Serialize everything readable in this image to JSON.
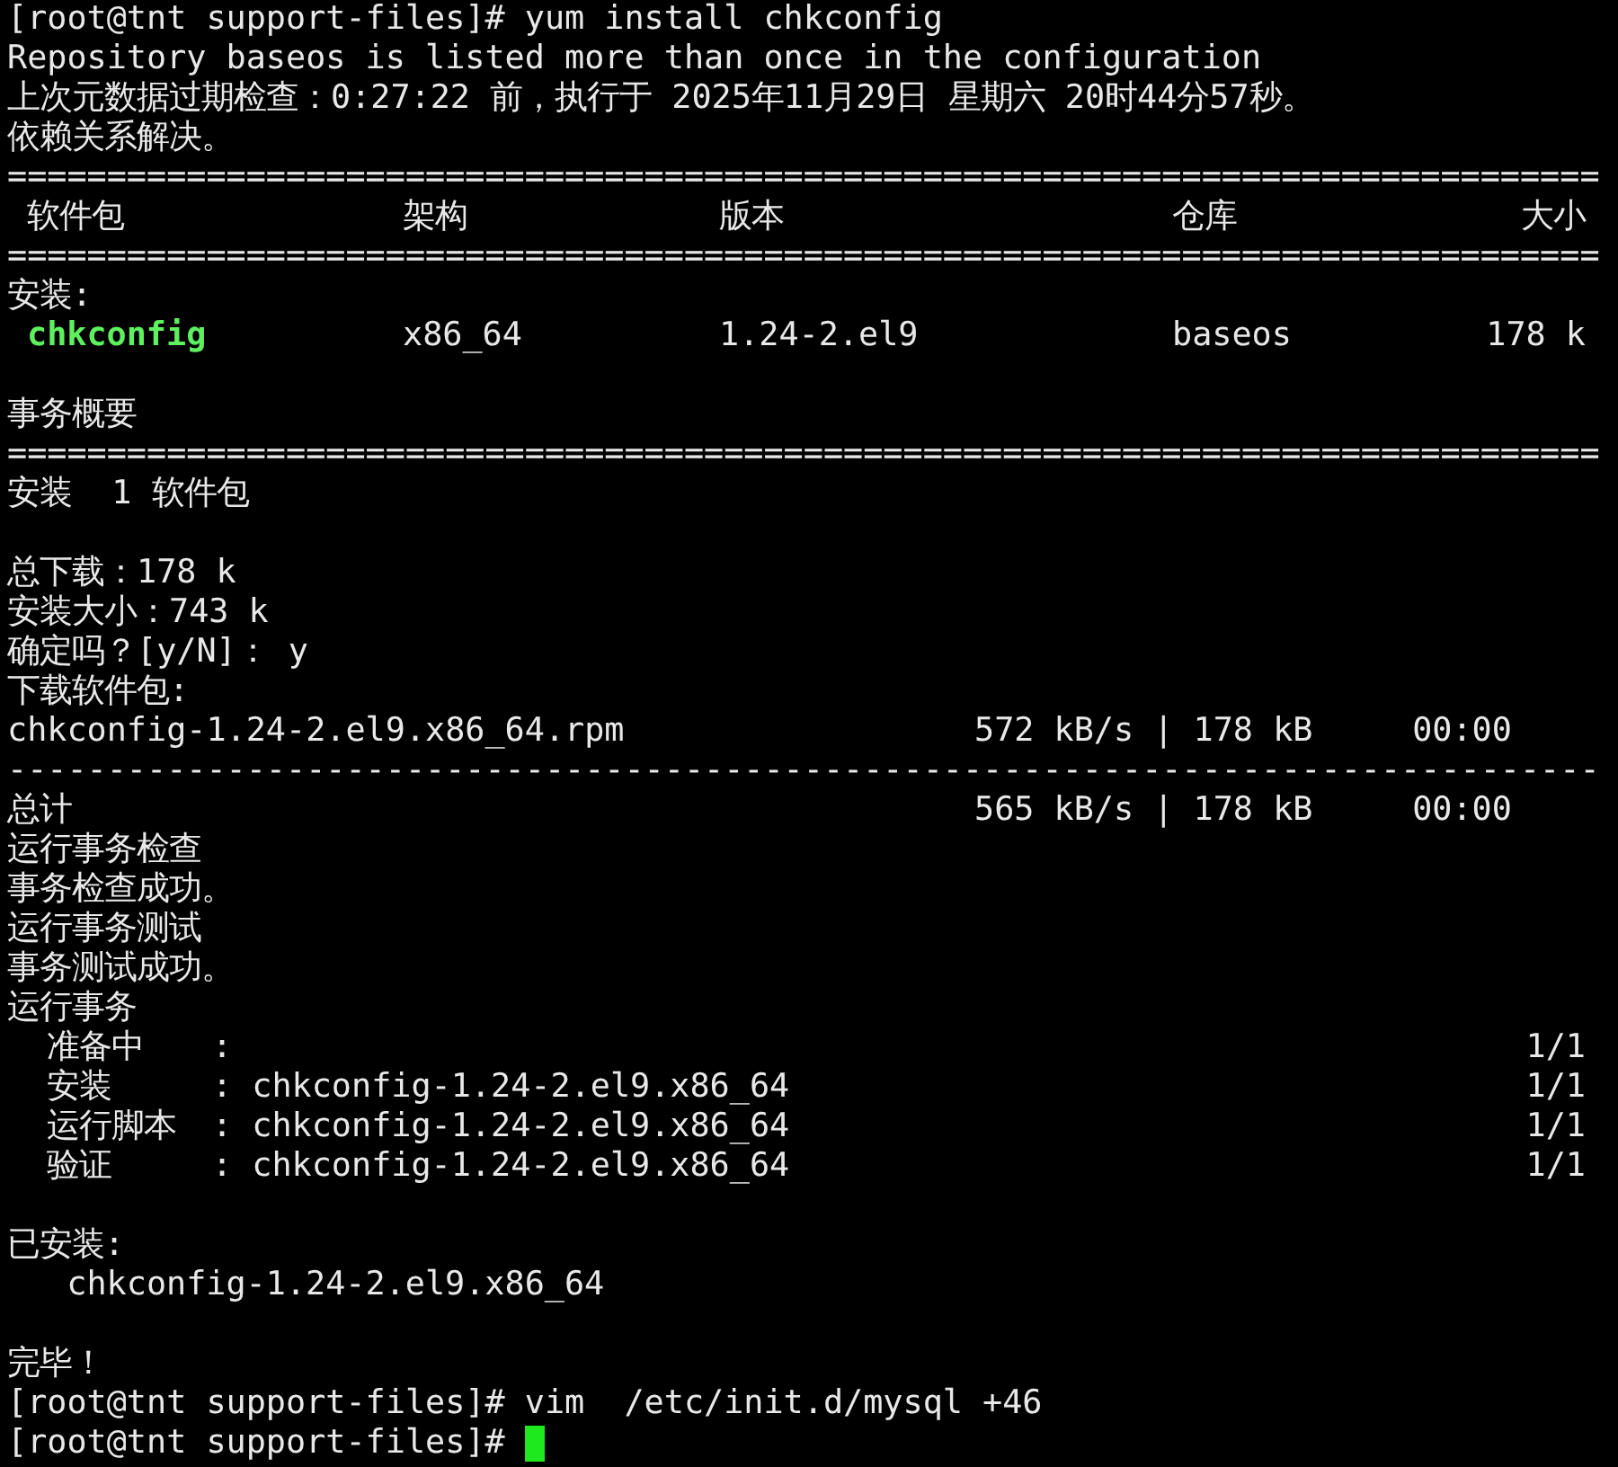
{
  "lines": [
    {
      "kind": "prompt",
      "text": "[root@tnt support-files]# yum install chkconfig",
      "cursor": false
    },
    {
      "kind": "text",
      "text": "Repository baseos is listed more than once in the configuration"
    },
    {
      "kind": "text",
      "text": "上次元数据过期检查：0:27:22 前，执行于 2025年11月29日 星期六 20时44分57秒。"
    },
    {
      "kind": "text",
      "text": "依赖关系解决。"
    },
    {
      "kind": "rule",
      "text": "================================================================================"
    },
    {
      "kind": "columns",
      "emphasis": false,
      "cells": [
        "软件包",
        "架构",
        "版本",
        "仓库",
        "大小"
      ]
    },
    {
      "kind": "rule",
      "text": "================================================================================"
    },
    {
      "kind": "text",
      "text": "安装:"
    },
    {
      "kind": "columns",
      "emphasis": true,
      "cells": [
        "chkconfig",
        "x86_64",
        "1.24-2.el9",
        "baseos",
        "178 k"
      ]
    },
    {
      "kind": "blank"
    },
    {
      "kind": "text",
      "text": "事务概要"
    },
    {
      "kind": "rule",
      "text": "================================================================================"
    },
    {
      "kind": "text",
      "text": "安装  1 软件包"
    },
    {
      "kind": "blank"
    },
    {
      "kind": "text",
      "text": "总下载：178 k"
    },
    {
      "kind": "text",
      "text": "安装大小：743 k"
    },
    {
      "kind": "text",
      "text": "确定吗？[y/N]： y"
    },
    {
      "kind": "text",
      "text": "下载软件包:"
    },
    {
      "kind": "transfer",
      "name": "chkconfig-1.24-2.el9.x86_64.rpm",
      "stats": "572 kB/s | 178 kB     00:00"
    },
    {
      "kind": "rule",
      "text": "--------------------------------------------------------------------------------"
    },
    {
      "kind": "transfer",
      "name": "总计",
      "stats": "565 kB/s | 178 kB     00:00"
    },
    {
      "kind": "text",
      "text": "运行事务检查"
    },
    {
      "kind": "text",
      "text": "事务检查成功。"
    },
    {
      "kind": "text",
      "text": "运行事务测试"
    },
    {
      "kind": "text",
      "text": "事务测试成功。"
    },
    {
      "kind": "text",
      "text": "运行事务"
    },
    {
      "kind": "step",
      "label": "准备中",
      "detail": ":",
      "count": "1/1"
    },
    {
      "kind": "step",
      "label": "安装",
      "detail": ": chkconfig-1.24-2.el9.x86_64",
      "count": "1/1"
    },
    {
      "kind": "step",
      "label": "运行脚本",
      "detail": ": chkconfig-1.24-2.el9.x86_64",
      "count": "1/1"
    },
    {
      "kind": "step",
      "label": "验证",
      "detail": ": chkconfig-1.24-2.el9.x86_64",
      "count": "1/1"
    },
    {
      "kind": "blank"
    },
    {
      "kind": "text",
      "text": "已安装:"
    },
    {
      "kind": "indented",
      "text": "chkconfig-1.24-2.el9.x86_64"
    },
    {
      "kind": "blank"
    },
    {
      "kind": "text",
      "text": "完毕！"
    },
    {
      "kind": "prompt",
      "text": "[root@tnt support-files]# vim  /etc/init.d/mysql +46",
      "cursor": false
    },
    {
      "kind": "prompt",
      "text": "[root@tnt support-files]#",
      "cursor": true
    }
  ]
}
